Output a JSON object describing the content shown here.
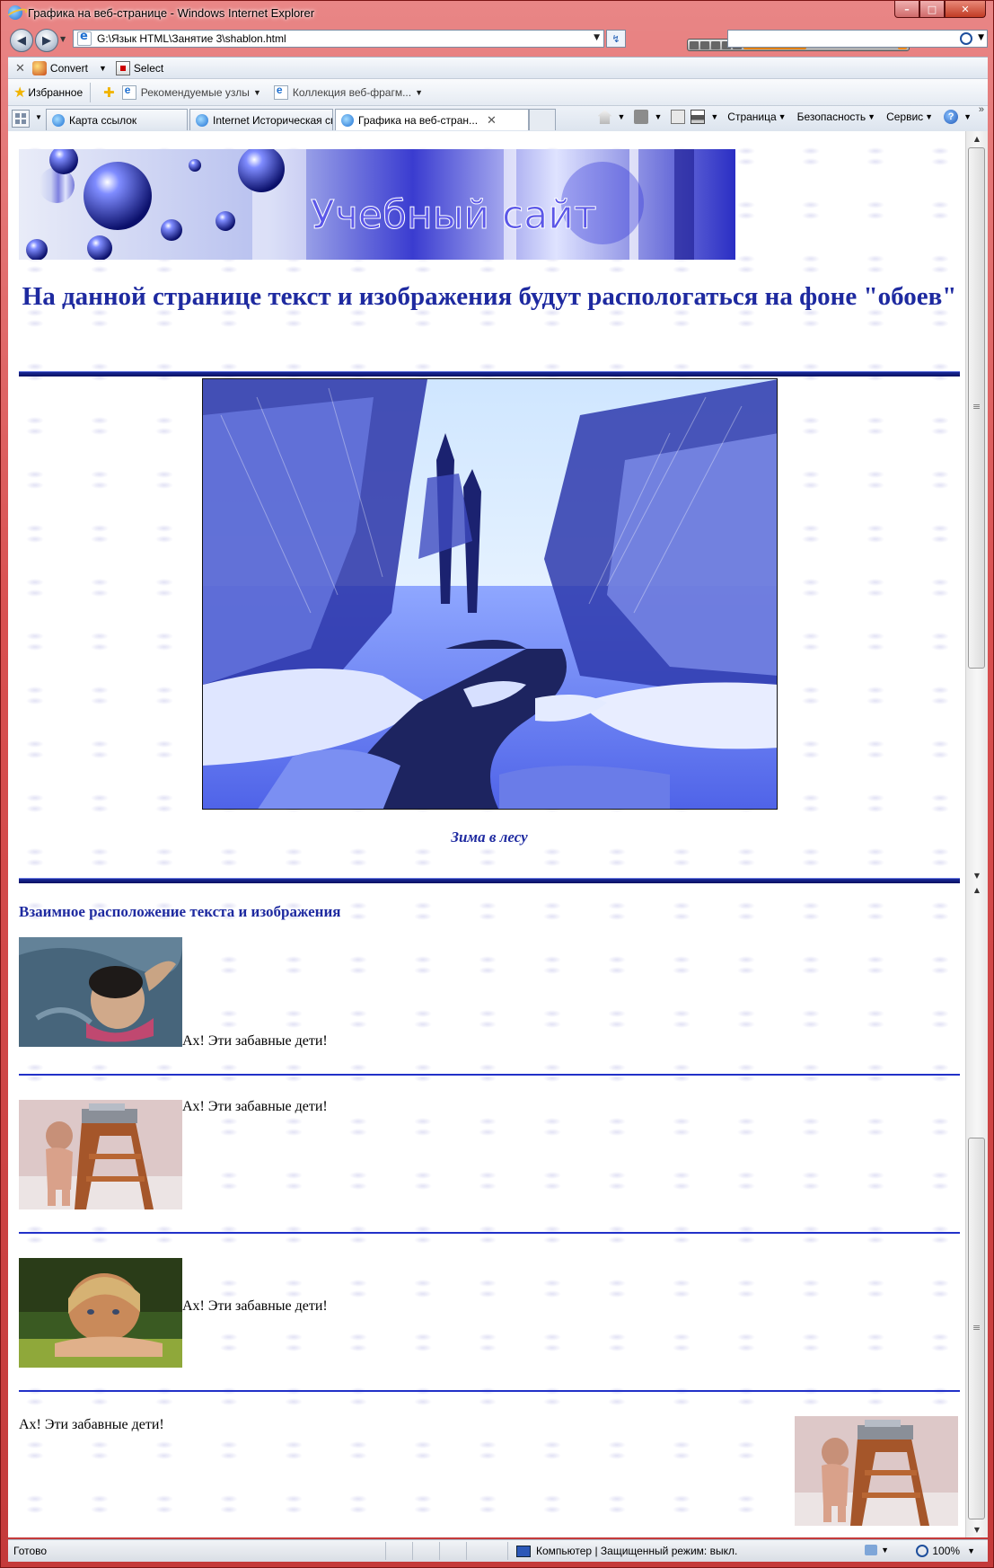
{
  "window": {
    "title": "Графика на веб-странице - Windows Internet Explorer",
    "minimize": "–",
    "maximize": "□",
    "close": "✕"
  },
  "address_bar": {
    "url": "G:\\Язык HTML\\Занятие 3\\shablon.html"
  },
  "command_bar": {
    "convert_label": "Convert",
    "select_label": "Select"
  },
  "favorites_bar": {
    "favorites_label": "Избранное",
    "items": [
      {
        "label": "Рекомендуемые узлы"
      },
      {
        "label": "Коллекция веб-фрагм..."
      }
    ]
  },
  "tabs": [
    {
      "label": "Карта ссылок",
      "active": false
    },
    {
      "label": "Internet Историческая сп...",
      "active": false
    },
    {
      "label": "Графика на веб-стран...",
      "active": true
    }
  ],
  "toolbar_menus": {
    "page": "Страница",
    "safety": "Безопасность",
    "tools": "Сервис"
  },
  "page": {
    "heading": "На данной странице текст и изображения будут распологаться на фоне \"обоев\"",
    "image_caption": "Зима в лесу",
    "section_title": "Взаимное расположение текста и изображения",
    "fun_text": "Ах! Эти забавные дети!",
    "banner_text": "Учебный сайт"
  },
  "status_bar": {
    "status": "Готово",
    "zone": "Компьютер | Защищенный режим: выкл.",
    "zoom": "100%"
  },
  "colors": {
    "heading_blue": "#1e2aa0",
    "frame_red": "#c62f2f"
  }
}
